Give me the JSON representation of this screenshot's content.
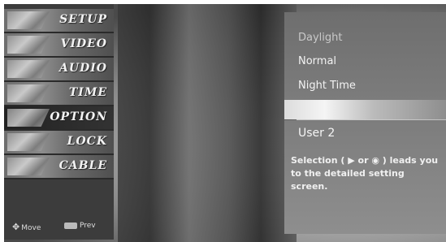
{
  "menu": {
    "items": [
      {
        "label": "SETUP",
        "icon": "setup-icon"
      },
      {
        "label": "VIDEO",
        "icon": "video-icon"
      },
      {
        "label": "AUDIO",
        "icon": "audio-icon"
      },
      {
        "label": "TIME",
        "icon": "time-icon"
      },
      {
        "label": "OPTION",
        "icon": "option-icon"
      },
      {
        "label": "LOCK",
        "icon": "lock-icon"
      },
      {
        "label": "CABLE",
        "icon": "cable-icon"
      }
    ],
    "footer": {
      "move_label": "Move",
      "move_icon": "dpad-icon",
      "menu_key": "MENU",
      "prev_label": "Prev"
    }
  },
  "options": {
    "items": [
      "Daylight",
      "Normal",
      "Night Time"
    ]
  },
  "detail": {
    "item": "User 2",
    "help": "Selection ( ▶ or ◉ ) leads you to the detailed setting screen."
  }
}
